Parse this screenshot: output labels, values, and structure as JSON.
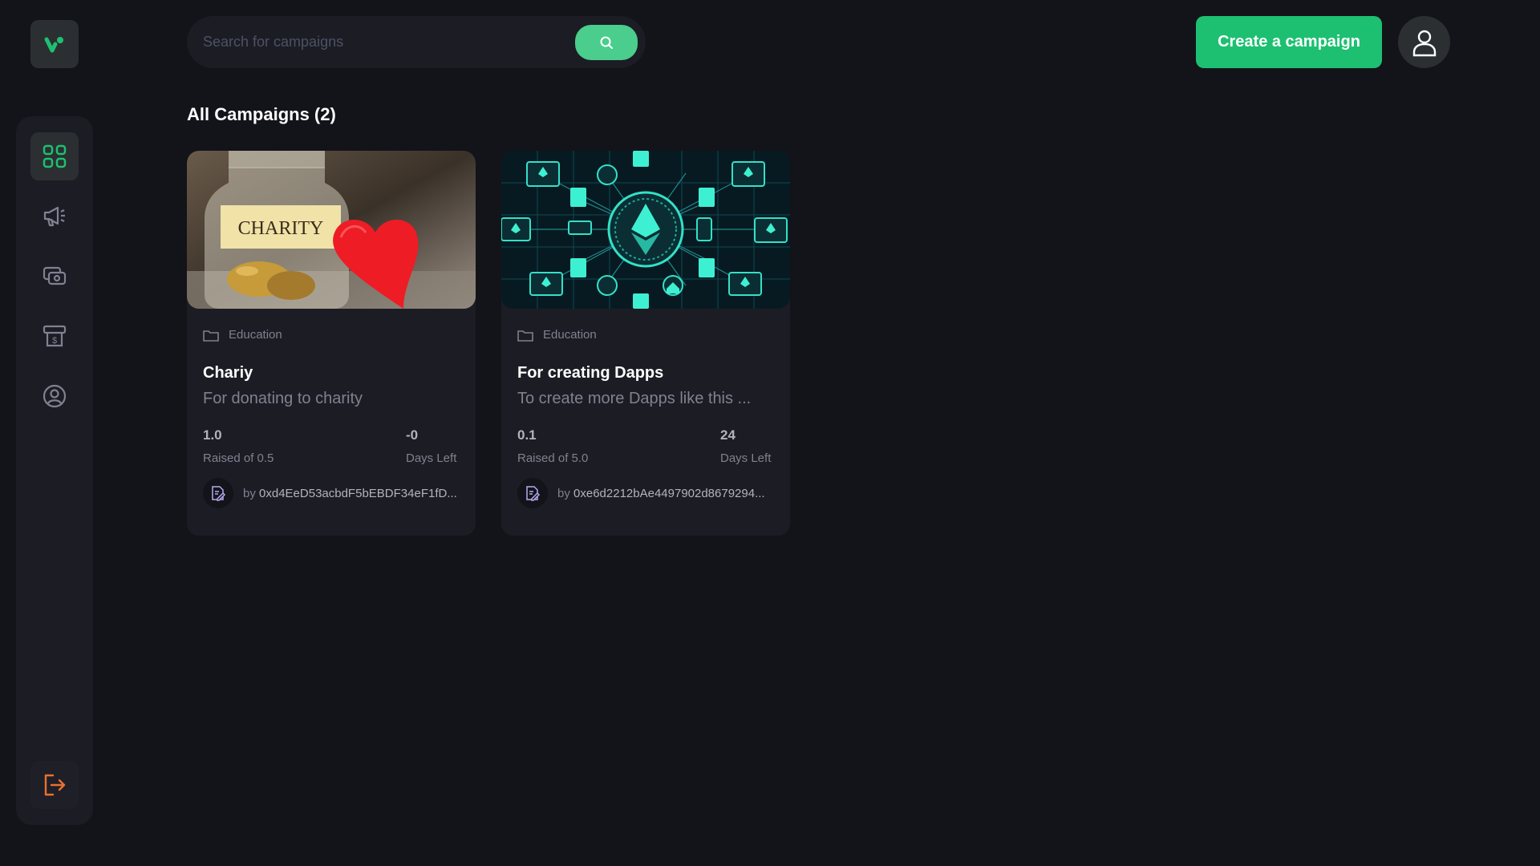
{
  "app": {
    "logo_icon": "brand-v-logo-icon",
    "accent": "#1dc071",
    "accent_light": "#4acd8d"
  },
  "sidebar": {
    "items": [
      {
        "name": "dashboard",
        "icon": "dashboard-grid-icon",
        "active": true
      },
      {
        "name": "campaign",
        "icon": "megaphone-icon",
        "active": false
      },
      {
        "name": "payment",
        "icon": "payment-icon",
        "active": false
      },
      {
        "name": "withdraw",
        "icon": "withdraw-icon",
        "active": false
      },
      {
        "name": "profile",
        "icon": "profile-icon",
        "active": false
      }
    ],
    "logout_icon": "logout-icon"
  },
  "header": {
    "search_placeholder": "Search for campaigns",
    "search_icon": "search-icon",
    "create_label": "Create a campaign",
    "profile_icon": "user-icon"
  },
  "main": {
    "heading": "All Campaigns (2)",
    "campaigns": [
      {
        "image": "charity-jar-with-heart",
        "image_text": "CHARITY",
        "category": "Education",
        "title": "Chariy",
        "description": "For donating to charity",
        "raised": "1.0",
        "raised_label": "Raised of 0.5",
        "days": "-0",
        "days_label": "Days Left",
        "by": "by",
        "owner": "0xd4EeD53acbdF5bEBDF34eF1fD..."
      },
      {
        "image": "ethereum-network-illustration",
        "category": "Education",
        "title": "For creating Dapps",
        "description": "To create more Dapps like this ...",
        "raised": "0.1",
        "raised_label": "Raised of 5.0",
        "days": "24",
        "days_label": "Days Left",
        "by": "by",
        "owner": "0xe6d2212bAe4497902d8679294..."
      }
    ]
  }
}
